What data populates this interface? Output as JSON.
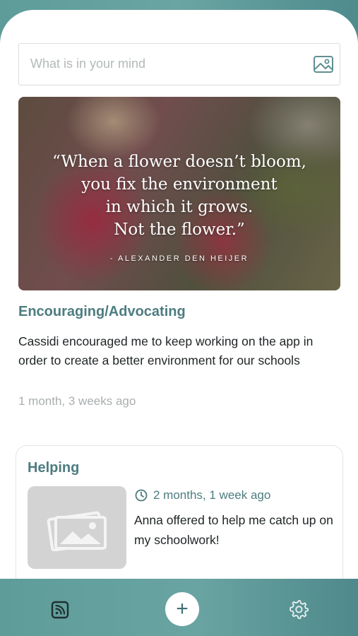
{
  "composer": {
    "placeholder": "What is in your mind"
  },
  "posts": [
    {
      "quote_lines": [
        "“When a flower doesn’t bloom,",
        "you fix the environment",
        "in which it grows.",
        "Not the flower.”"
      ],
      "quote_author": "- ALEXANDER DEN HEIJER",
      "title": "Encouraging/Advocating",
      "body": "Cassidi encouraged me to keep working on the app in order to create a better environment for our schools",
      "time": "1 month, 3 weeks ago"
    },
    {
      "title": "Helping",
      "time": "2 months, 1 week ago",
      "body": "Anna offered to help me catch up on my schoolwork!"
    }
  ],
  "tabbar": {
    "feed_icon": "feed-icon",
    "add_label": "+",
    "settings_icon": "gear-icon"
  },
  "colors": {
    "accent": "#4d7c80",
    "tabbar": "#5e9c9a"
  }
}
